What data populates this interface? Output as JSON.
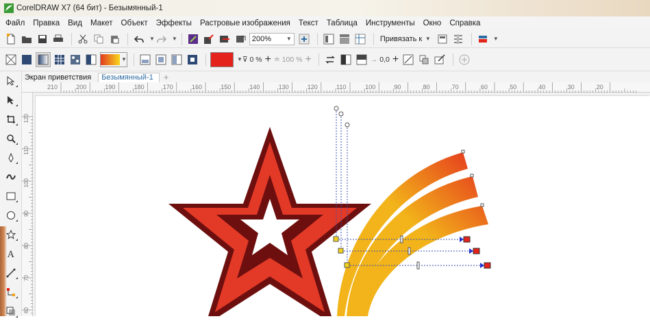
{
  "window": {
    "title": "CorelDRAW X7 (64 бит) - Безымянный-1"
  },
  "menu": [
    "Файл",
    "Правка",
    "Вид",
    "Макет",
    "Объект",
    "Эффекты",
    "Растровые изображения",
    "Текст",
    "Таблица",
    "Инструменты",
    "Окно",
    "Справка"
  ],
  "toolbar": {
    "zoom": "200%",
    "snap_to": "Привязать к"
  },
  "property_bar": {
    "transparency": "0 %",
    "opacity": "100 %",
    "offset": "0,0"
  },
  "doc_tabs": [
    "Экран приветствия",
    "Безымянный-1"
  ],
  "ruler": {
    "h_labels": [
      "210",
      "200",
      "190",
      "180",
      "170",
      "160",
      "150",
      "140",
      "130",
      "120",
      "110",
      "100",
      "90",
      "80",
      "70",
      "60",
      "50",
      "40",
      "30",
      "20"
    ],
    "v_labels": [
      "120",
      "110",
      "100",
      "90",
      "80",
      "70",
      "60"
    ]
  },
  "colors": {
    "star_outer": "#6e0f0f",
    "star_fill": "#e23a26",
    "ribbon_start": "#f2b41a",
    "ribbon_end": "#e5381e",
    "fill_swatch": "#e3231c",
    "accent_tab": "#2d6ca2"
  }
}
